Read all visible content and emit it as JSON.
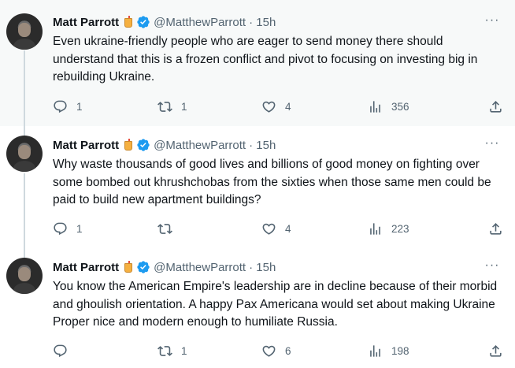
{
  "tweets": [
    {
      "name": "Matt Parrott",
      "handle": "@MatthewParrott",
      "time": "· 15h",
      "text": "Even ukraine-friendly people who are eager to send money there should understand that this is a frozen conflict and pivot to focusing on investing big in rebuilding Ukraine.",
      "replies": "1",
      "retweets": "1",
      "likes": "4",
      "views": "356"
    },
    {
      "name": "Matt Parrott",
      "handle": "@MatthewParrott",
      "time": "· 15h",
      "text": "Why waste thousands of good lives and billions of good money on fighting over some bombed out khrushchobas from the sixties when those same men could be paid to build new apartment buildings?",
      "replies": "1",
      "retweets": "",
      "likes": "4",
      "views": "223"
    },
    {
      "name": "Matt Parrott",
      "handle": "@MatthewParrott",
      "time": "· 15h",
      "text": "You know the American Empire's leadership are in decline because of their morbid and ghoulish orientation. A happy Pax Americana would set about making Ukraine Proper nice and modern enough to humiliate Russia.",
      "replies": "",
      "retweets": "1",
      "likes": "6",
      "views": "198"
    }
  ],
  "icons": {
    "name_emoji": "cup-with-straw-icon",
    "verified": "verified-badge-icon",
    "more": "more-icon",
    "reply": "reply-icon",
    "retweet": "retweet-icon",
    "like": "heart-icon",
    "views": "views-icon",
    "share": "share-icon"
  },
  "colors": {
    "accent": "#1d9bf0",
    "muted": "#536471",
    "text": "#0f1419",
    "highlight_bg": "#f7f9f9"
  }
}
